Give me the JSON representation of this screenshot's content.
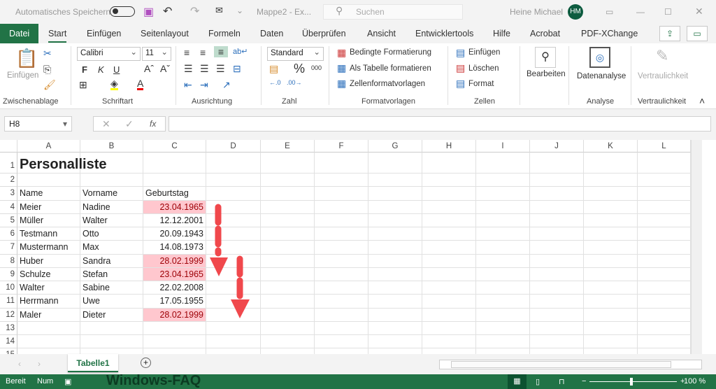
{
  "titlebar": {
    "autosave": "Automatisches Speichern",
    "autosave_on": false,
    "doc_title": "Mappe2 - Ex...",
    "search_placeholder": "Suchen",
    "user": "Heine Michael",
    "initials": "HM"
  },
  "tabs": [
    "Datei",
    "Start",
    "Einfügen",
    "Seitenlayout",
    "Formeln",
    "Daten",
    "Überprüfen",
    "Ansicht",
    "Entwicklertools",
    "Hilfe",
    "Acrobat",
    "PDF-XChange"
  ],
  "ribbon": {
    "clipboard": {
      "paste": "Einfügen",
      "group": "Zwischenablage"
    },
    "font": {
      "name": "Calibri",
      "size": "11",
      "bold": "F",
      "italic": "K",
      "underline": "U",
      "group": "Schriftart"
    },
    "alignment": {
      "group": "Ausrichtung"
    },
    "number": {
      "format": "Standard",
      "group": "Zahl"
    },
    "styles": {
      "conditional": "Bedingte Formatierung",
      "table": "Als Tabelle formatieren",
      "cellstyles": "Zellenformatvorlagen",
      "group": "Formatvorlagen"
    },
    "cells": {
      "insert": "Einfügen",
      "delete": "Löschen",
      "format": "Format",
      "group": "Zellen"
    },
    "editing": {
      "label": "Bearbeiten"
    },
    "analysis": {
      "label": "Datenanalyse",
      "group": "Analyse"
    },
    "sensitivity": {
      "label": "Vertraulichkeit",
      "group": "Vertraulichkeit"
    }
  },
  "formula": {
    "namebox": "H8",
    "value": ""
  },
  "sheet": {
    "columns": [
      "A",
      "B",
      "C",
      "D",
      "E",
      "F",
      "G",
      "H",
      "I",
      "J",
      "K",
      "L"
    ],
    "rows": [
      {
        "n": "1",
        "cells": [
          "Personalliste",
          "",
          ""
        ]
      },
      {
        "n": "2",
        "cells": [
          "",
          "",
          ""
        ]
      },
      {
        "n": "3",
        "cells": [
          "Name",
          "Vorname",
          "Geburtstag"
        ]
      },
      {
        "n": "4",
        "cells": [
          "Meier",
          "Nadine",
          "23.04.1965"
        ],
        "dup": true
      },
      {
        "n": "5",
        "cells": [
          "Müller",
          "Walter",
          "12.12.2001"
        ]
      },
      {
        "n": "6",
        "cells": [
          "Testmann",
          "Otto",
          "20.09.1943"
        ]
      },
      {
        "n": "7",
        "cells": [
          "Mustermann",
          "Max",
          "14.08.1973"
        ]
      },
      {
        "n": "8",
        "cells": [
          "Huber",
          "Sandra",
          "28.02.1999"
        ],
        "dup": true
      },
      {
        "n": "9",
        "cells": [
          "Schulze",
          "Stefan",
          "23.04.1965"
        ],
        "dup": true
      },
      {
        "n": "10",
        "cells": [
          "Walter",
          "Sabine",
          "22.02.2008"
        ]
      },
      {
        "n": "11",
        "cells": [
          "Herrmann",
          "Uwe",
          "17.05.1955"
        ]
      },
      {
        "n": "12",
        "cells": [
          "Maler",
          "Dieter",
          "28.02.1999"
        ],
        "dup": true
      },
      {
        "n": "13",
        "cells": [
          "",
          "",
          ""
        ]
      },
      {
        "n": "14",
        "cells": [
          "",
          "",
          ""
        ]
      },
      {
        "n": "15",
        "cells": [
          "",
          "",
          ""
        ]
      }
    ],
    "highlight_fill": "#ffc7ce",
    "highlight_text": "#9c0006"
  },
  "sheet_tabs": [
    "Tabelle1"
  ],
  "status": {
    "ready": "Bereit",
    "num": "Num",
    "watermark": "Windows-FAQ",
    "zoom": "100 %"
  },
  "colors": {
    "accent": "#217346",
    "arrow": "#f0484c"
  }
}
